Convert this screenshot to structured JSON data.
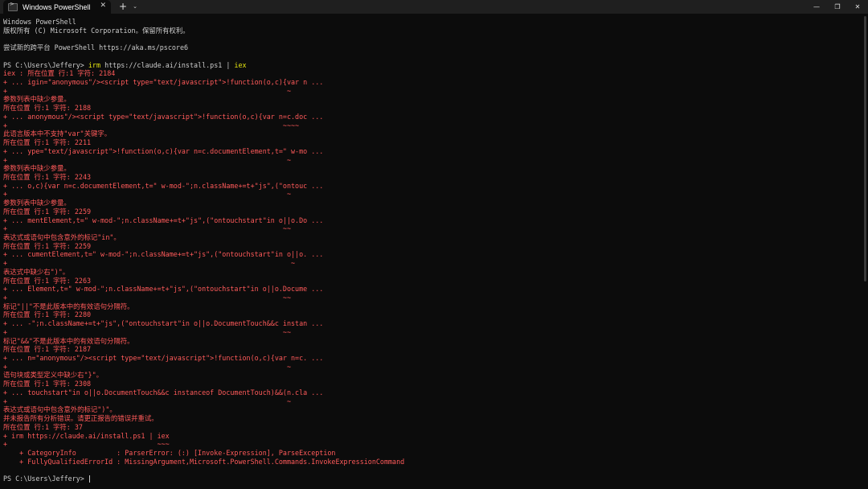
{
  "window": {
    "tab_title": "Windows PowerShell",
    "tab_icon": "terminal-icon",
    "close_tab": "✕",
    "new_tab": "+",
    "dropdown": "⌄",
    "minimize": "—",
    "maximize": "❐",
    "close": "✕"
  },
  "prompt": {
    "text": "PS C:\\Users\\Jeffery> ",
    "irm": "irm",
    "url": " https://claude.ai/install.ps1 | ",
    "iex": "iex"
  },
  "lines": [
    {
      "t": "Windows PowerShell",
      "c": "white"
    },
    {
      "t": "版权所有 (C) Microsoft Corporation。保留所有权利。",
      "c": "white"
    },
    {
      "t": "",
      "c": "white"
    },
    {
      "t": "尝试新的跨平台 PowerShell https://aka.ms/pscore6",
      "c": "white"
    },
    {
      "t": "",
      "c": "white"
    },
    {
      "t": "__PROMPT_CMD__",
      "c": "white"
    },
    {
      "t": "iex : 所在位置 行:1 字符: 2184",
      "c": "red"
    },
    {
      "t": "+ ... igin=\"anonymous\"/><script type=\"text/javascript\">!function(o,c){var n ...",
      "c": "red"
    },
    {
      "t": "+                                                                     ~",
      "c": "red"
    },
    {
      "t": "参数列表中缺少参量。",
      "c": "red"
    },
    {
      "t": "所在位置 行:1 字符: 2188",
      "c": "red"
    },
    {
      "t": "+ ... anonymous\"/><script type=\"text/javascript\">!function(o,c){var n=c.doc ...",
      "c": "red"
    },
    {
      "t": "+                                                                    ~~~~",
      "c": "red"
    },
    {
      "t": "此语言版本中不支持\"var\"关键字。",
      "c": "red"
    },
    {
      "t": "所在位置 行:1 字符: 2211",
      "c": "red"
    },
    {
      "t": "+ ... ype=\"text/javascript\">!function(o,c){var n=c.documentElement,t=\" w-mo ...",
      "c": "red"
    },
    {
      "t": "+                                                                     ~",
      "c": "red"
    },
    {
      "t": "参数列表中缺少参量。",
      "c": "red"
    },
    {
      "t": "所在位置 行:1 字符: 2243",
      "c": "red"
    },
    {
      "t": "+ ... o,c){var n=c.documentElement,t=\" w-mod-\";n.className+=t+\"js\",(\"ontouc ...",
      "c": "red"
    },
    {
      "t": "+                                                                     ~",
      "c": "red"
    },
    {
      "t": "参数列表中缺少参量。",
      "c": "red"
    },
    {
      "t": "所在位置 行:1 字符: 2259",
      "c": "red"
    },
    {
      "t": "+ ... mentElement,t=\" w-mod-\";n.className+=t+\"js\",(\"ontouchstart\"in o||o.Do ...",
      "c": "red"
    },
    {
      "t": "+                                                                    ~~",
      "c": "red"
    },
    {
      "t": "表达式或语句中包含意外的标记\"in\"。",
      "c": "red"
    },
    {
      "t": "所在位置 行:1 字符: 2259",
      "c": "red"
    },
    {
      "t": "+ ... cumentElement,t=\" w-mod-\";n.className+=t+\"js\",(\"ontouchstart\"in o||o. ...",
      "c": "red"
    },
    {
      "t": "+                                                                      ~",
      "c": "red"
    },
    {
      "t": "表达式中缺少右\")\"。",
      "c": "red"
    },
    {
      "t": "所在位置 行:1 字符: 2263",
      "c": "red"
    },
    {
      "t": "+ ... Element,t=\" w-mod-\";n.className+=t+\"js\",(\"ontouchstart\"in o||o.Docume ...",
      "c": "red"
    },
    {
      "t": "+                                                                    ~~",
      "c": "red"
    },
    {
      "t": "标记\"||\"不是此版本中的有效语句分隔符。",
      "c": "red"
    },
    {
      "t": "所在位置 行:1 字符: 2280",
      "c": "red"
    },
    {
      "t": "+ ... -\";n.className+=t+\"js\",(\"ontouchstart\"in o||o.DocumentTouch&&c instan ...",
      "c": "red"
    },
    {
      "t": "+                                                                    ~~",
      "c": "red"
    },
    {
      "t": "标记\"&&\"不是此版本中的有效语句分隔符。",
      "c": "red"
    },
    {
      "t": "所在位置 行:1 字符: 2187",
      "c": "red"
    },
    {
      "t": "+ ... n=\"anonymous\"/><script type=\"text/javascript\">!function(o,c){var n=c. ...",
      "c": "red"
    },
    {
      "t": "+                                                                     ~",
      "c": "red"
    },
    {
      "t": "语句块或类型定义中缺少右\"}\"。",
      "c": "red"
    },
    {
      "t": "所在位置 行:1 字符: 2308",
      "c": "red"
    },
    {
      "t": "+ ... touchstart\"in o||o.DocumentTouch&&c instanceof DocumentTouch)&&(n.cla ...",
      "c": "red"
    },
    {
      "t": "+                                                                     ~",
      "c": "red"
    },
    {
      "t": "表达式或语句中包含意外的标记\")\"。",
      "c": "red"
    },
    {
      "t": "并未报告所有分析错误。请更正报告的错误并重试。",
      "c": "red"
    },
    {
      "t": "所在位置 行:1 字符: 37",
      "c": "red"
    },
    {
      "t": "+ irm https://claude.ai/install.ps1 | iex",
      "c": "red"
    },
    {
      "t": "+                                     ~~~",
      "c": "red"
    },
    {
      "t": "    + CategoryInfo          : ParserError: (:) [Invoke-Expression], ParseException",
      "c": "red"
    },
    {
      "t": "    + FullyQualifiedErrorId : MissingArgument,Microsoft.PowerShell.Commands.InvokeExpressionCommand",
      "c": "red"
    },
    {
      "t": "",
      "c": "white"
    },
    {
      "t": "PS C:\\Users\\Jeffery> ",
      "c": "white",
      "cursor": true
    }
  ]
}
